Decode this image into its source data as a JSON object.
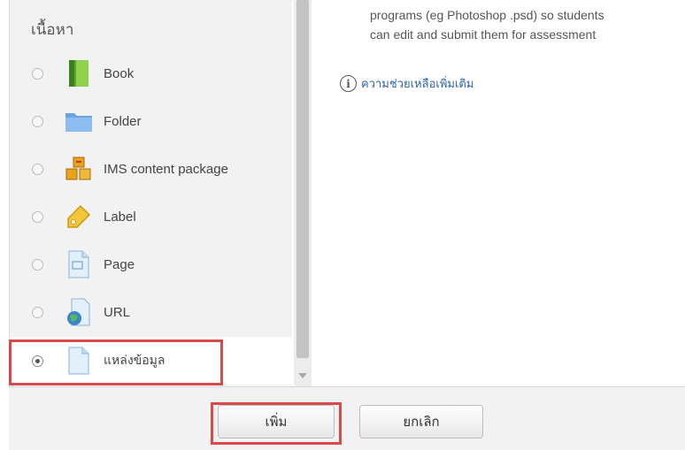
{
  "section_heading": "เนื้อหา",
  "modules": [
    {
      "label": "Book",
      "icon": "book-icon",
      "selected": false
    },
    {
      "label": "Folder",
      "icon": "folder-icon",
      "selected": false
    },
    {
      "label": "IMS content package",
      "icon": "ims-package-icon",
      "selected": false
    },
    {
      "label": "Label",
      "icon": "label-tag-icon",
      "selected": false
    },
    {
      "label": "Page",
      "icon": "page-icon",
      "selected": false
    },
    {
      "label": "URL",
      "icon": "url-globe-icon",
      "selected": false
    },
    {
      "label": "แหล่งข้อมูล",
      "icon": "file-resource-icon",
      "selected": true
    }
  ],
  "description": {
    "line1": "programs (eg Photoshop .psd) so students",
    "line2": "can edit and submit them for assessment"
  },
  "help_link": "ความช่วยเหลือเพิ่มเติม",
  "footer": {
    "add_label": "เพิ่ม",
    "cancel_label": "ยกเลิก"
  },
  "colors": {
    "highlight": "#d9484b",
    "link": "#2b63b0",
    "panel_bg": "#f2f2f2"
  }
}
